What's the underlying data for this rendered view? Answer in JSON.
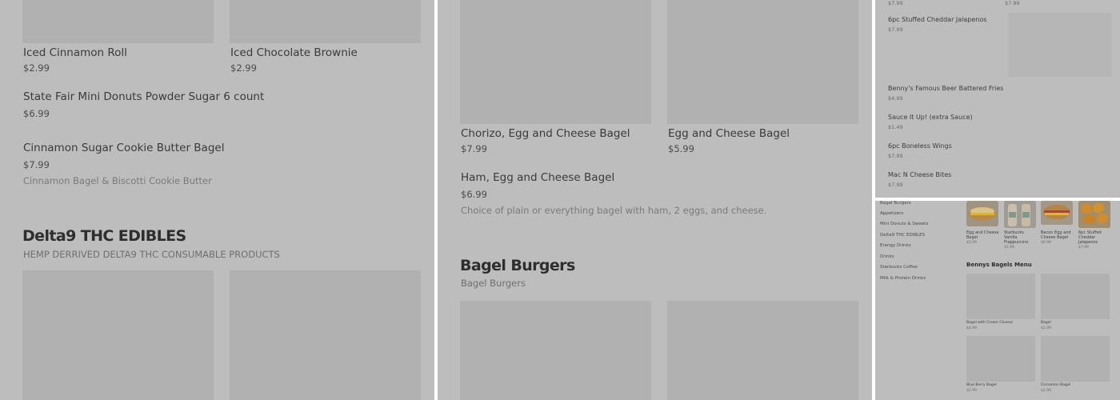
{
  "panel_left": {
    "items_top": [
      {
        "title": "Iced Cinnamon Roll",
        "price": "$2.99"
      },
      {
        "title": "Iced Chocolate Brownie",
        "price": "$2.99"
      }
    ],
    "donuts": {
      "title": "State Fair Mini Donuts Powder Sugar 6 count",
      "price": "$6.99"
    },
    "cookie_bagel": {
      "title": "Cinnamon Sugar Cookie Butter Bagel",
      "price": "$7.99",
      "description": "Cinnamon Bagel & Biscotti Cookie Butter"
    },
    "section": {
      "title": "Delta9 THC EDIBLES",
      "subtitle": "HEMP DERRIVED DELTA9 THC CONSUMABLE PRODUCTS"
    }
  },
  "panel_middle": {
    "items_top": [
      {
        "title": "Chorizo, Egg and Cheese Bagel",
        "price": "$7.99"
      },
      {
        "title": "Egg and Cheese Bagel",
        "price": "$5.99"
      }
    ],
    "ham_bagel": {
      "title": "Ham, Egg and Cheese Bagel",
      "price": "$6.99",
      "description": "Choice of plain or everything bagel with ham, 2 eggs, and cheese."
    },
    "section": {
      "title": "Bagel Burgers",
      "subtitle": "Bagel Burgers"
    }
  },
  "panel_right_top": {
    "top_prices": [
      "$7.99",
      "$7.99"
    ],
    "items": [
      {
        "title": "6pc Stuffed Cheddar Jalapenos",
        "price": "$7.99"
      },
      {
        "title": "Benny's Famous Beer Battered Fries",
        "price": "$4.99"
      },
      {
        "title": "Sauce It Up! (extra Sauce)",
        "price": "$1.49"
      },
      {
        "title": "6pc Boneless Wings",
        "price": "$7.99"
      },
      {
        "title": "Mac N Cheese Bites",
        "price": "$7.99"
      }
    ]
  },
  "panel_right_bottom": {
    "nav": [
      "Bagel Burgers",
      "Appetizers",
      "Mini Donuts & Sweets",
      "Delta9 THC EDIBLES",
      "Energy Drinks",
      "Drinks",
      "Starbucks Coffee",
      "Milk & Protein Drinks"
    ],
    "featured": [
      {
        "title": "Egg and Cheese Bagel",
        "price": "$5.99"
      },
      {
        "title": "Starbucks Vanilla Frappuccino",
        "price": "$5.99"
      },
      {
        "title": "Bacon Egg and Cheese Bagel",
        "price": "$6.99"
      },
      {
        "title": "6pc Stuffed Cheddar Jalapenos",
        "price": "$7.99"
      }
    ],
    "menu_title": "Bennys Bagels Menu",
    "menu_items": [
      {
        "title": "Bagel with Cream Cheese",
        "price": "$4.99"
      },
      {
        "title": "Bagel",
        "price": "$2.99"
      },
      {
        "title": "Blue Berry Bagel",
        "price": "$2.99"
      },
      {
        "title": "Cinnamon Bagel",
        "price": "$2.99"
      }
    ]
  },
  "colors": {
    "overlay": "#bdbdbd",
    "placeholder": "#b1b1b1",
    "divider": "#ffffff"
  }
}
